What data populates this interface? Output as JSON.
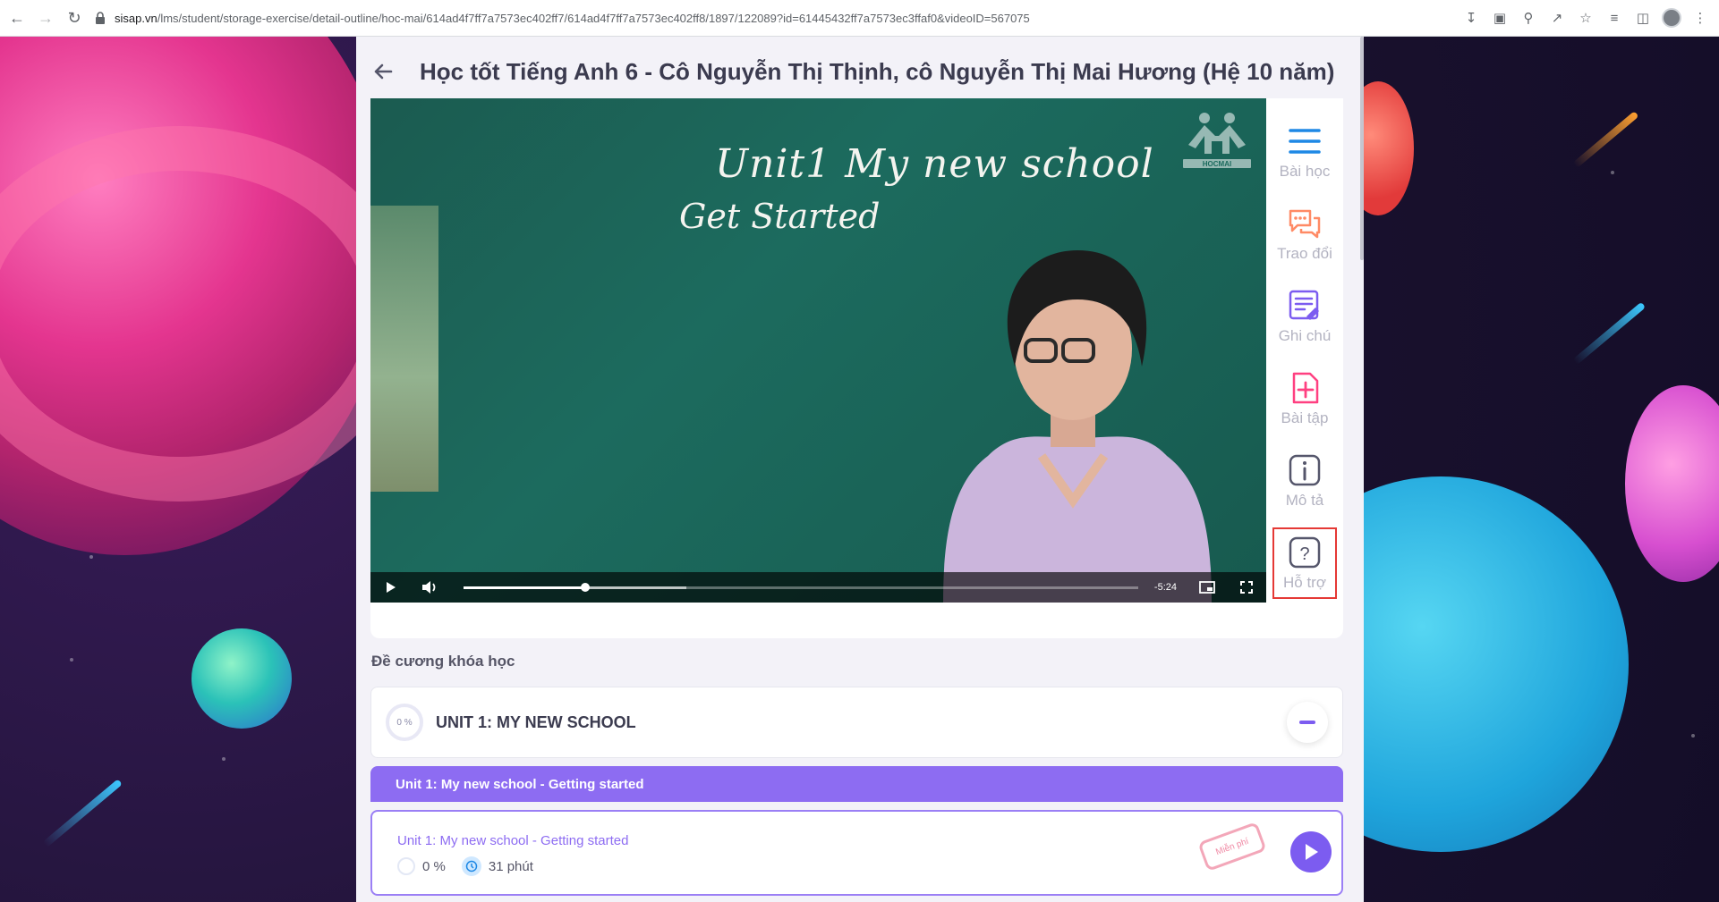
{
  "browser": {
    "url_host": "sisap.vn",
    "url_path": "/lms/student/storage-exercise/detail-outline/hoc-mai/614ad4f7ff7a7573ec402ff7/614ad4f7ff7a7573ec402ff8/1897/122089?id=61445432ff7a7573ec3ffaf0&videoID=567075"
  },
  "page": {
    "title": "Học tốt Tiếng Anh 6 - Cô Nguyễn Thị Thịnh, cô Nguyễn Thị Mai Hương (Hệ 10 năm)"
  },
  "video": {
    "board_line1": "Unit1 My new school",
    "board_line2": "Get Started",
    "logo_text": "HOCMAI",
    "time_remaining": "-5:24",
    "progress": 0.18,
    "buffered": 0.33
  },
  "side_tools": [
    {
      "label": "Bài học",
      "icon": "menu-icon",
      "color": "#1e88e5"
    },
    {
      "label": "Trao đổi",
      "icon": "chat-icon",
      "color": "#ff8a65"
    },
    {
      "label": "Ghi chú",
      "icon": "note-icon",
      "color": "#7c5cf0"
    },
    {
      "label": "Bài tập",
      "icon": "add-file-icon",
      "color": "#ff4081"
    },
    {
      "label": "Mô tả",
      "icon": "info-icon",
      "color": "#55566b"
    },
    {
      "label": "Hỗ trợ",
      "icon": "help-icon",
      "color": "#55566b"
    }
  ],
  "outline": {
    "section_label": "Đề cương khóa học",
    "unit": {
      "progress_label": "0 %",
      "title": "UNIT 1: MY NEW SCHOOL"
    },
    "lesson_header": "Unit 1: My new school - Getting started",
    "lesson": {
      "title": "Unit 1: My new school - Getting started",
      "progress": "0 %",
      "duration": "31 phút",
      "badge": "Miễn phí"
    }
  }
}
